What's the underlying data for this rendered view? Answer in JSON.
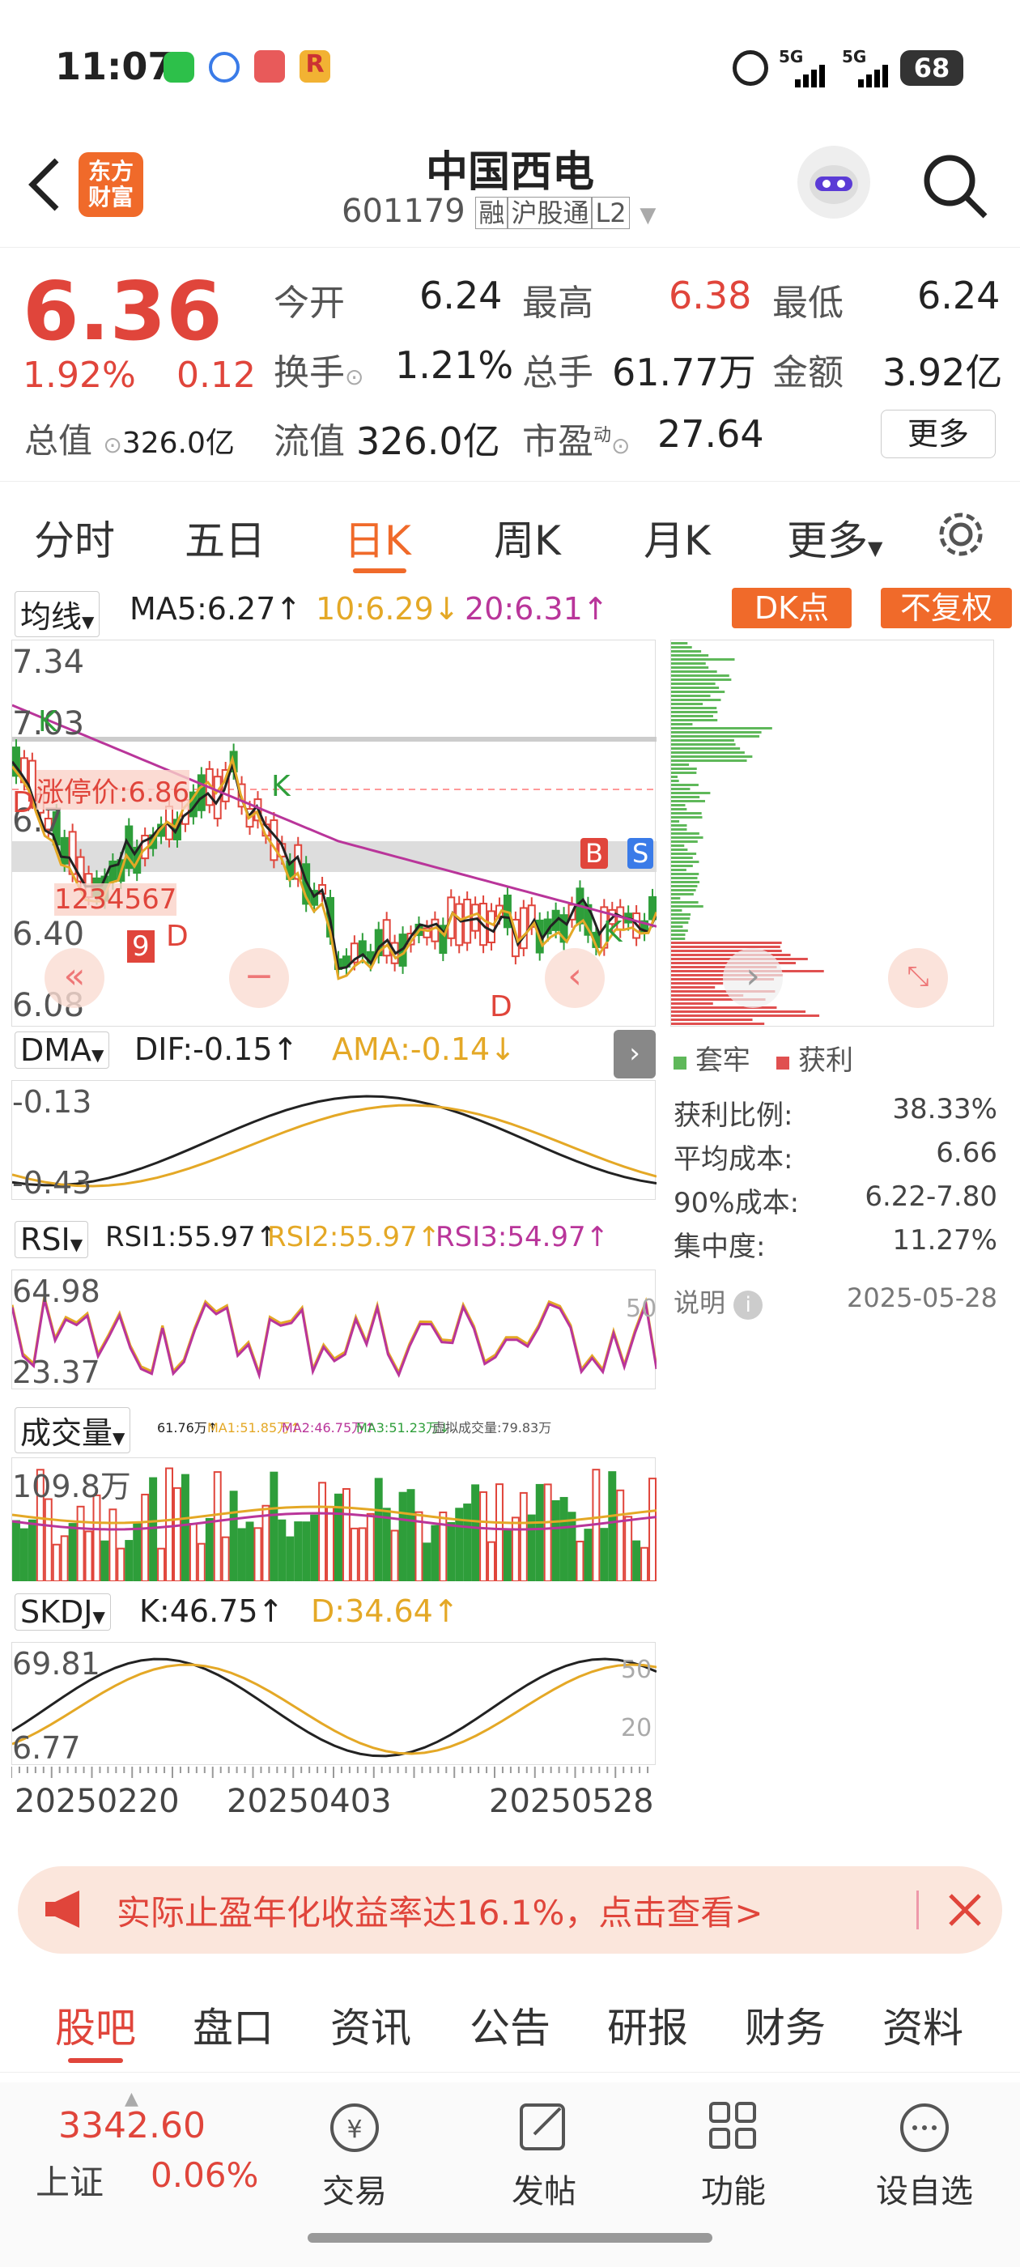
{
  "status": {
    "time": "11:07",
    "battery": "68",
    "net1": "5G",
    "net2": "5G"
  },
  "nav": {
    "title": "中国西电",
    "code": "601179",
    "tag1": "融",
    "tag2": "沪股通",
    "tag3": "L2",
    "logo_line1": "东方",
    "logo_line2": "财富"
  },
  "quote": {
    "price": "6.36",
    "pct": "1.92%",
    "chg": "0.12",
    "cap_label": "总值",
    "cap_value": "326.0亿",
    "open_label": "今开",
    "open": "6.24",
    "high_label": "最高",
    "high": "6.38",
    "low_label": "最低",
    "low": "6.24",
    "turnover_label": "换手",
    "turnover": "1.21%",
    "vol_label": "总手",
    "vol": "61.77万",
    "amount_label": "金额",
    "amount": "3.92亿",
    "float_label": "流值",
    "float": "326.0亿",
    "pe_label": "市盈",
    "pe_sup": "动",
    "pe": "27.64",
    "more": "更多"
  },
  "tabs": [
    "分时",
    "五日",
    "日K",
    "周K",
    "月K",
    "更多"
  ],
  "active_tab": 2,
  "ma": {
    "select": "均线",
    "ma5": "MA5:6.27↑",
    "ma10": "10:6.29↓",
    "ma20": "20:6.31↑",
    "dk": "DK点",
    "fq": "不复权"
  },
  "kline": {
    "y_labels": [
      "7.34",
      "7.03",
      "6.7",
      "6.40",
      "6.08"
    ],
    "limit_label": "涨停价:6.86",
    "marks": [
      "K",
      "D",
      "K",
      "D",
      "K",
      "D",
      "9",
      "B",
      "S"
    ],
    "seq": "1234567"
  },
  "dma": {
    "select": "DMA",
    "dif": "DIF:-0.15↑",
    "ama": "AMA:-0.14↓",
    "y1": "-0.13",
    "y2": "-0.43"
  },
  "rsi": {
    "select": "RSI",
    "r1": "RSI1:55.97↑",
    "r2": "RSI2:55.97↑",
    "r3": "RSI3:54.97↑",
    "y1": "64.98",
    "y2": "23.37",
    "ref": "50"
  },
  "volume": {
    "select": "成交量",
    "v": "61.76万↑",
    "ma1": "MA1:51.85万↑",
    "ma2": "MA2:46.75万↑",
    "ma3": "MA3:51.23万↓",
    "virt": "虚拟成交量:79.83万",
    "y1": "109.8万"
  },
  "skdj": {
    "select": "SKDJ",
    "k": "K:46.75↑",
    "d": "D:34.64↑",
    "y1": "69.81",
    "y2": "6.77",
    "ref1": "50",
    "ref2": "20"
  },
  "dates": [
    "20250220",
    "20250403",
    "20250528"
  ],
  "chips": {
    "legend1": "套牢",
    "legend2": "获利",
    "rows": [
      [
        "获利比例:",
        "38.33%"
      ],
      [
        "平均成本:",
        "6.66"
      ],
      [
        "90%成本:",
        "6.22-7.80"
      ],
      [
        "集中度:",
        "11.27%"
      ]
    ],
    "note": "说明",
    "date": "2025-05-28"
  },
  "banner": {
    "text": "实际止盈年化收益率达16.1%，点击查看>"
  },
  "btabs": [
    "股吧",
    "盘口",
    "资讯",
    "公告",
    "研报",
    "财务",
    "资料"
  ],
  "bottom": {
    "index_value": "3342.60",
    "index_name": "上证",
    "index_pct": "0.06%",
    "items": [
      "交易",
      "发帖",
      "功能",
      "设自选"
    ]
  },
  "colors": {
    "up": "#e0453b",
    "down": "#2e9e3a",
    "accent": "#f06a2a",
    "ma10": "#e4a826",
    "ma20": "#b9359a"
  }
}
